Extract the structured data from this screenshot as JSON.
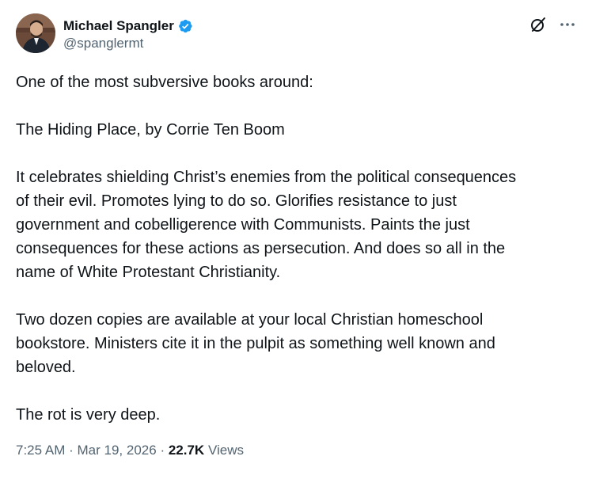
{
  "author": {
    "display_name": "Michael Spangler",
    "handle": "@spanglermt",
    "verified": true,
    "verified_color": "#1d9bf0"
  },
  "actions": {
    "grok_icon": "grok-icon",
    "more_icon": "more-icon"
  },
  "tweet": {
    "paragraphs": [
      [
        "One of the most subversive books around:"
      ],
      [
        "The Hiding Place, by Corrie Ten Boom"
      ],
      [
        "It celebrates shielding Christ’s enemies from the political consequences",
        "of their evil. Promotes lying to do so. Glorifies resistance to just",
        "government and cobelligerence with Communists. Paints the just",
        "consequences for these actions as persecution. And does so all in the",
        "name of White Protestant Christianity."
      ],
      [
        "Two dozen copies are available at your local Christian homeschool",
        "bookstore. Ministers cite it in the pulpit as something well known and",
        "beloved."
      ],
      [
        "The rot is very deep."
      ]
    ]
  },
  "meta": {
    "time": "7:25 AM",
    "separator": "·",
    "date": "Mar 19, 2026",
    "views_count": "22.7K",
    "views_label": "Views"
  },
  "colors": {
    "text_primary": "#0f1419",
    "text_secondary": "#536471",
    "accent": "#1d9bf0"
  }
}
